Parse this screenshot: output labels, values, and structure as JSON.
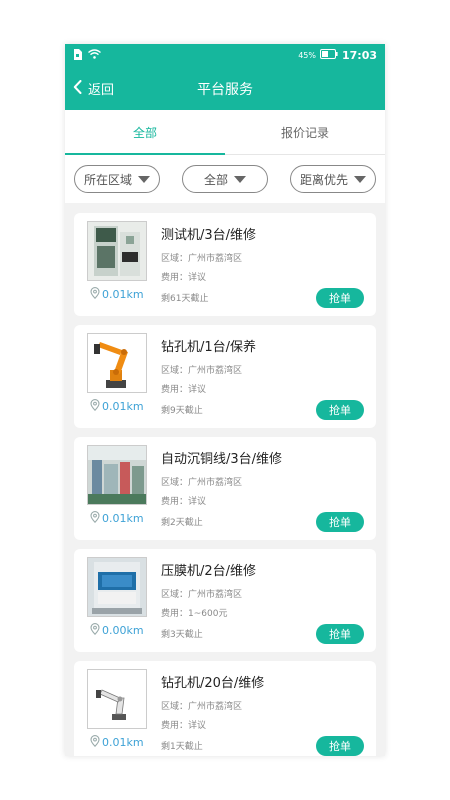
{
  "status_bar": {
    "battery": "45%",
    "time": "17:03"
  },
  "appbar": {
    "back_label": "返回",
    "title": "平台服务"
  },
  "tabs": [
    {
      "label": "全部",
      "active": true
    },
    {
      "label": "报价记录",
      "active": false
    }
  ],
  "filters": [
    {
      "label": "所在区域"
    },
    {
      "label": "全部"
    },
    {
      "label": "距离优先"
    }
  ],
  "colors": {
    "primary": "#16b79d",
    "distance": "#3ea2d6"
  },
  "orders": [
    {
      "title": "测试机/3台/维修",
      "region": "区域：广州市荔湾区",
      "fee": "费用：详议",
      "remaining": "剩61天截止",
      "distance": "0.01km",
      "action": "抢单",
      "image": "test-machine"
    },
    {
      "title": "钻孔机/1台/保养",
      "region": "区域：广州市荔湾区",
      "fee": "费用：详议",
      "remaining": "剩9天截止",
      "distance": "0.01km",
      "action": "抢单",
      "image": "orange-robot-arm"
    },
    {
      "title": "自动沉铜线/3台/维修",
      "region": "区域：广州市荔湾区",
      "fee": "费用：详议",
      "remaining": "剩2天截止",
      "distance": "0.01km",
      "action": "抢单",
      "image": "factory-line"
    },
    {
      "title": "压膜机/2台/维修",
      "region": "区域：广州市荔湾区",
      "fee": "费用：1~600元",
      "remaining": "剩3天截止",
      "distance": "0.00km",
      "action": "抢单",
      "image": "laminator"
    },
    {
      "title": "钻孔机/20台/维修",
      "region": "区域：广州市荔湾区",
      "fee": "费用：详议",
      "remaining": "剩1天截止",
      "distance": "0.01km",
      "action": "抢单",
      "image": "white-robot-arm"
    }
  ]
}
